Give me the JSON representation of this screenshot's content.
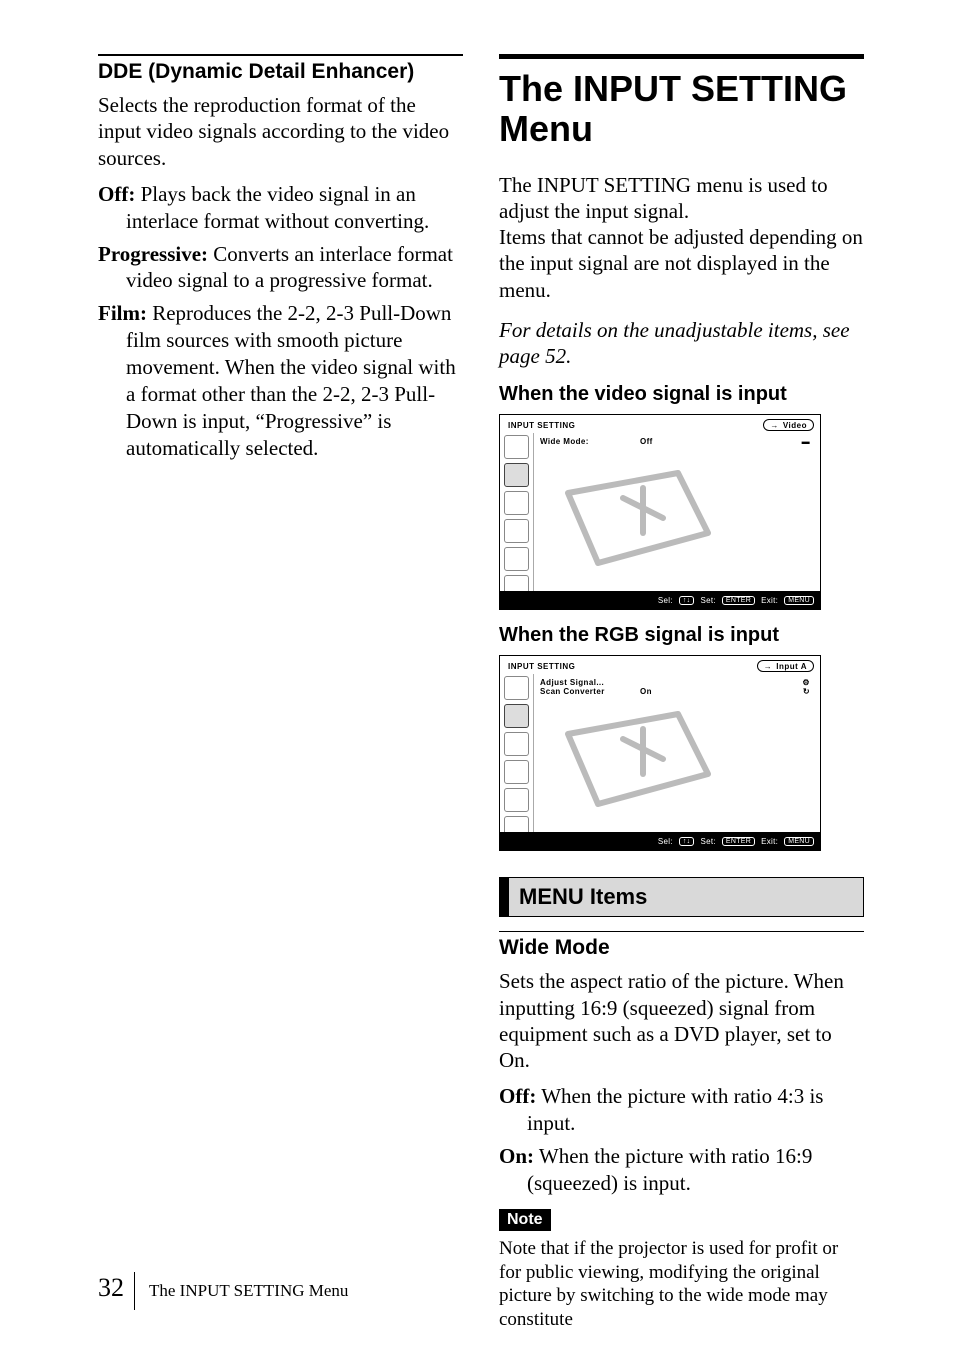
{
  "left": {
    "heading": "DDE (Dynamic Detail Enhancer)",
    "intro": "Selects the reproduction format of the input video signals according to the video sources.",
    "items": [
      {
        "term": "Off:",
        "def": " Plays back the video signal in an interlace format without converting."
      },
      {
        "term": "Progressive:",
        "def": " Converts an interlace format video signal to a progressive format."
      },
      {
        "term": "Film:",
        "def": " Reproduces the 2-2, 2-3 Pull-Down film sources with smooth picture movement. When the video signal with a format other than the 2-2, 2-3 Pull-Down is input, “Progressive” is automatically selected."
      }
    ]
  },
  "right": {
    "title": "The INPUT SETTING Menu",
    "intro1": "The INPUT SETTING menu is used to adjust the input signal.",
    "intro2": "Items that cannot be adjusted depending on the input signal are not displayed in the menu.",
    "italic_note": "For details on the unadjustable items, see page 52.",
    "sec1_heading": "When the video signal is input",
    "sec2_heading": "When the RGB signal is input",
    "screenshot1": {
      "title": "INPUT SETTING",
      "source": "Video",
      "rows": [
        {
          "label": "Wide Mode:",
          "value": "Off",
          "right_icon": "▬"
        }
      ],
      "footer": {
        "sel": "Sel:",
        "sel_badge": "↑↓",
        "set": "Set:",
        "set_badge": "ENTER",
        "exit": "Exit:",
        "exit_badge": "MENU"
      }
    },
    "screenshot2": {
      "title": "INPUT SETTING",
      "source": "Input A",
      "rows": [
        {
          "label": "Adjust Signal...",
          "value": "",
          "right_icon": "⚙"
        },
        {
          "label": "Scan Converter",
          "value": "On",
          "right_icon": "↻"
        }
      ],
      "footer": {
        "sel": "Sel:",
        "sel_badge": "↑↓",
        "set": "Set:",
        "set_badge": "ENTER",
        "exit": "Exit:",
        "exit_badge": "MENU"
      }
    },
    "menu_items_heading": "MENU Items",
    "wide_mode": {
      "heading": "Wide Mode",
      "body": "Sets the aspect ratio of the picture. When inputting 16:9 (squeezed) signal from equipment such as a DVD player, set to On.",
      "off": {
        "term": "Off:",
        "def": " When the picture with ratio 4:3 is input."
      },
      "on": {
        "term": "On:",
        "def": " When the picture with ratio 16:9 (squeezed) is input."
      }
    },
    "note_label": "Note",
    "note_body": "Note that if the projector is used for profit or for public viewing, modifying the original picture by switching to the wide mode may constitute"
  },
  "footer": {
    "page": "32",
    "title": "The INPUT SETTING Menu"
  }
}
